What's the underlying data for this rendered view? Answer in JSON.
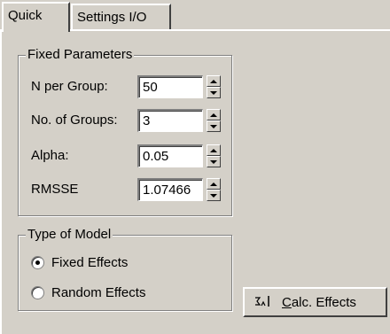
{
  "tabs": [
    {
      "label": "Quick",
      "active": true
    },
    {
      "label": "Settings I/O",
      "active": false
    }
  ],
  "fixed_parameters": {
    "title": "Fixed Parameters",
    "rows": [
      {
        "label": "N per Group:",
        "value": "50"
      },
      {
        "label": "No. of Groups:",
        "value": "3"
      },
      {
        "label": "Alpha:",
        "value": "0.05"
      },
      {
        "label": "RMSSE",
        "value": "1.07466"
      }
    ]
  },
  "type_of_model": {
    "title": "Type of Model",
    "options": [
      {
        "label": "Fixed Effects",
        "selected": true
      },
      {
        "label": "Random Effects",
        "selected": false
      }
    ]
  },
  "calc_button": {
    "icon": "calc-effects-icon",
    "mnemonic": "C",
    "rest": "alc. Effects"
  },
  "colors": {
    "face": "#d4d0c8",
    "shadow": "#808080",
    "highlight": "#ffffff"
  }
}
